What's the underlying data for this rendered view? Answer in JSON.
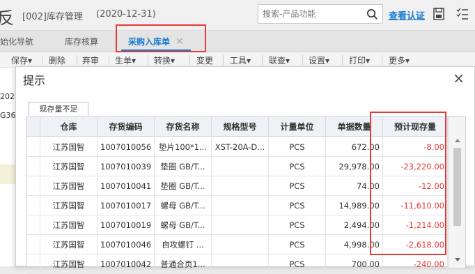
{
  "header": {
    "app_char": "反",
    "account": "[002]库存管理",
    "date": "(2020-12-31)",
    "search_placeholder": "搜索-产品功能",
    "cert_link": "查看认证"
  },
  "tabs": [
    {
      "label": "始化导航"
    },
    {
      "label": "库存核算"
    },
    {
      "label": "采购入库单",
      "active": true,
      "close": "✕"
    }
  ],
  "toolbar": [
    {
      "label": "保存▾"
    },
    {
      "label": "删除"
    },
    {
      "label": "弃审"
    },
    {
      "label": "生单▾"
    },
    {
      "label": "转换▾"
    },
    {
      "label": "变更"
    },
    {
      "label": "工具▾"
    },
    {
      "label": "联查▾"
    },
    {
      "label": "设置▾"
    },
    {
      "label": "打印▾"
    },
    {
      "label": "更多▾"
    }
  ],
  "background_rows": [
    "202",
    "G36"
  ],
  "dialog": {
    "title": "提示",
    "close": "×",
    "inner_tab": "现存量不足",
    "columns": [
      "仓库",
      "存货编码",
      "存货名称",
      "规格型号",
      "计量单位",
      "单据数量",
      "预计现存量"
    ],
    "rows": [
      {
        "warehouse": "江苏国智",
        "code": "1007010056",
        "name": "垫片100*1...",
        "spec": "XST-20A-D...",
        "unit": "PCS",
        "qty": "672.00",
        "projected": "-8.00"
      },
      {
        "warehouse": "江苏国智",
        "code": "1007010039",
        "name": "垫圈 GB/T...",
        "spec": "",
        "unit": "PCS",
        "qty": "29,978.00",
        "projected": "-23,220.00"
      },
      {
        "warehouse": "江苏国智",
        "code": "1007010041",
        "name": "垫圈 GB/T...",
        "spec": "",
        "unit": "PCS",
        "qty": "74.00",
        "projected": "-12.00"
      },
      {
        "warehouse": "江苏国智",
        "code": "1007010017",
        "name": "螺母 GB/T...",
        "spec": "",
        "unit": "PCS",
        "qty": "14,989.00",
        "projected": "-11,610.00"
      },
      {
        "warehouse": "江苏国智",
        "code": "1007010019",
        "name": "螺母 GB/T...",
        "spec": "",
        "unit": "PCS",
        "qty": "2,494.00",
        "projected": "-1,214.00"
      },
      {
        "warehouse": "江苏国智",
        "code": "1007010046",
        "name": "自攻螺钉 ...",
        "spec": "",
        "unit": "PCS",
        "qty": "4,998.00",
        "projected": "-2,618.00"
      },
      {
        "warehouse": "江苏国智",
        "code": "1007010042",
        "name": "普通合页1...",
        "spec": "",
        "unit": "PCS",
        "qty": "700.00",
        "projected": "-240.00"
      }
    ]
  },
  "colors": {
    "accent": "#1a7bd1",
    "highlight_box": "#e53935",
    "negative": "#e53935"
  }
}
